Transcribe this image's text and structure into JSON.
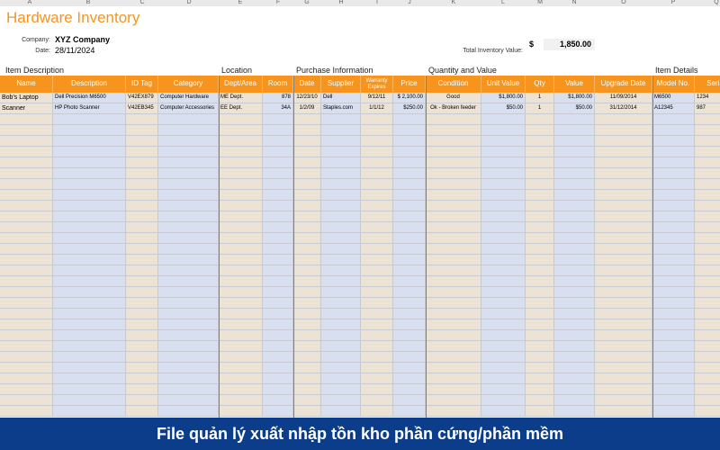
{
  "column_letters": [
    "A",
    "B",
    "C",
    "D",
    "E",
    "F",
    "G",
    "H",
    "I",
    "J",
    "K",
    "L",
    "M",
    "N",
    "O",
    "P",
    "Q"
  ],
  "title": "Hardware Inventory",
  "company_label": "Company:",
  "company_value": "XYZ Company",
  "date_label": "Date:",
  "date_value": "28/11/2024",
  "total_label": "Total Inventory Value:",
  "total_currency": "$",
  "total_value": "1,850.00",
  "groups": {
    "item_description": "Item Description",
    "location": "Location",
    "purchase": "Purchase Information",
    "quantity": "Quantity and Value",
    "item_details": "Item Details"
  },
  "headers": [
    "Name",
    "Description",
    "ID Tag",
    "Category",
    "Dept/Area",
    "Room",
    "Date",
    "Supplier",
    "Warranty Expires",
    "Price",
    "Condition",
    "Unit Value",
    "Qty",
    "Value",
    "Upgrade Date",
    "Model No.",
    "Serial"
  ],
  "rows": [
    [
      "Bob's Laptop",
      "Dell Precision M6500",
      "V42EX879",
      "Computer Hardware",
      "ME Dept.",
      "878",
      "12/23/10",
      "Dell",
      "9/12/11",
      "$ 2,100.00",
      "Good",
      "$1,800.00",
      "1",
      "$1,800.00",
      "11/09/2014",
      "M6500",
      "1234"
    ],
    [
      "Scanner",
      "HP Photo Scanner",
      "V42EB345",
      "Computer Accessories",
      "EE Dept.",
      "34A",
      "1/2/09",
      "Staples.com",
      "1/1/12",
      "$250.00",
      "Ok - Broken feeder",
      "$50.00",
      "1",
      "$50.00",
      "31/12/2014",
      "A12345",
      "987"
    ]
  ],
  "footer": "File quản lý xuất nhập tồn kho phần cứng/phần mềm"
}
